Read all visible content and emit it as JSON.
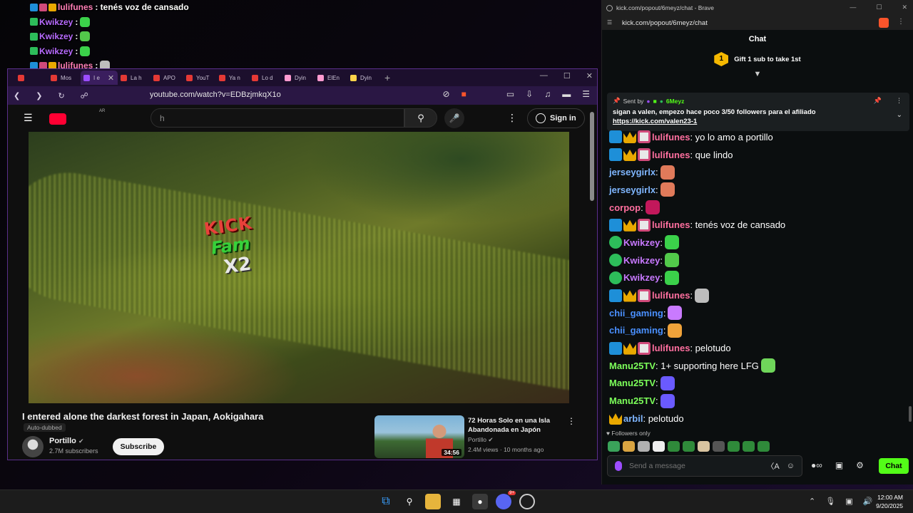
{
  "overlay_chat": [
    {
      "user": "lulifunes",
      "color": "#ff7eb6",
      "text": ": tenés voz de cansado",
      "badges": [
        "#1e8fd8",
        "#d04a7a",
        "#e9a800"
      ],
      "emote": ""
    },
    {
      "user": "Kwikzey",
      "color": "#b86bff",
      "text": ":",
      "badges": [
        "#2dbd5a"
      ],
      "emote": "#3bd14a"
    },
    {
      "user": "Kwikzey",
      "color": "#b86bff",
      "text": ":",
      "badges": [
        "#2dbd5a"
      ],
      "emote": "#52c94a"
    },
    {
      "user": "Kwikzey",
      "color": "#b86bff",
      "text": ":",
      "badges": [
        "#2dbd5a"
      ],
      "emote": "#3bd14a"
    },
    {
      "user": "lulifunes",
      "color": "#ff7eb6",
      "text": ":",
      "badges": [
        "#1e8fd8",
        "#d04a7a",
        "#e9a800"
      ],
      "emote": "#bdbdbd"
    },
    {
      "user": "chii_gaming",
      "color": "#4a90ff",
      "text": ":",
      "badges": [],
      "emote": "#c97aff"
    },
    {
      "user": "chii_gaming",
      "color": "#4a90ff",
      "text": ":",
      "badges": [],
      "emote": "#f0a33a"
    },
    {
      "user": "lulifunes",
      "color": "#ff7eb6",
      "text": ": pelotudo",
      "badges": [
        "#1e8fd8",
        "#d04a7a",
        "#e9a800"
      ],
      "emote": ""
    },
    {
      "user": "Manu25TV",
      "color": "#7cff5a",
      "text": ": 1+ supporting here LFG",
      "badges": [],
      "emote": "#3bd14a"
    },
    {
      "user": "Manu25TV",
      "color": "#7cff5a",
      "text": ":",
      "badges": [],
      "emote": "#6a5aff"
    },
    {
      "user": "Manu25TV",
      "color": "#7cff5a",
      "text": ":",
      "badges": [],
      "emote": "#6a5aff"
    },
    {
      "user": "arbil",
      "color": "#ffffff",
      "text": ": pelotudo",
      "badges": [
        "#e9a800"
      ],
      "emote": ""
    }
  ],
  "browser": {
    "tabs": [
      {
        "label": "",
        "active": false,
        "color": "#e53935"
      },
      {
        "label": "Mos",
        "active": false,
        "color": "#e53935"
      },
      {
        "label": "I e",
        "active": true,
        "color": "#9c4dff"
      },
      {
        "label": "La h",
        "active": false,
        "color": "#e53935"
      },
      {
        "label": "APO",
        "active": false,
        "color": "#e53935"
      },
      {
        "label": "YouT",
        "active": false,
        "color": "#e53935"
      },
      {
        "label": "Ya n",
        "active": false,
        "color": "#e53935"
      },
      {
        "label": "Lo d",
        "active": false,
        "color": "#e53935"
      },
      {
        "label": "Dyin",
        "active": false,
        "color": "#ff9bd0"
      },
      {
        "label": "ElEn",
        "active": false,
        "color": "#ff9bd0"
      },
      {
        "label": "Dyin",
        "active": false,
        "color": "#ffd54a"
      }
    ],
    "url": "youtube.com/watch?v=EDBzjmkqX1o"
  },
  "youtube": {
    "search_placeholder": "h",
    "sign_in": "Sign in",
    "logo_badge": "AR",
    "video_title": "I entered alone the darkest forest in Japan, Aokigahara",
    "auto_dubbed": "Auto-dubbed",
    "channel": "Portillo",
    "subscribers": "2.7M subscribers",
    "subscribe": "Subscribe",
    "overlay_logo": {
      "kick": "KICK",
      "fam": "Fam",
      "x2": "X2"
    },
    "recommendation": {
      "title": "72 Horas Solo en una Isla Abandonada en Japón",
      "channel": "Portillo",
      "meta": "2.4M views · 10 months ago",
      "duration": "34:56"
    }
  },
  "kick": {
    "window_title": "kick.com/popout/6meyz/chat - Brave",
    "url": "kick.com/popout/6meyz/chat",
    "header": "Chat",
    "gift_count": "1",
    "gift_text": "Gift 1 sub to take 1st",
    "pinned": {
      "sent_by": "Sent by",
      "sender": "6Meyz",
      "message": "sigan a valen, empezo hace poco 3/50 followers para el afiliado",
      "link": "https://kick.com/valen23-1"
    },
    "messages": [
      {
        "user": "lulifunes",
        "color": "#ff6f9f",
        "badges": [
          "mod",
          "vip",
          "og"
        ],
        "text": ": yo lo amo a portillo",
        "emote": ""
      },
      {
        "user": "lulifunes",
        "color": "#ff6f9f",
        "badges": [
          "mod",
          "vip",
          "og"
        ],
        "text": ": que lindo",
        "emote": ""
      },
      {
        "user": "jerseygirlx",
        "color": "#7fb6ff",
        "badges": [],
        "text": ":",
        "emote": "#e07a5a"
      },
      {
        "user": "jerseygirlx",
        "color": "#7fb6ff",
        "badges": [],
        "text": ":",
        "emote": "#e07a5a"
      },
      {
        "user": "corpop",
        "color": "#ff6f9f",
        "badges": [],
        "text": ":",
        "emote": "#c2185b"
      },
      {
        "user": "lulifunes",
        "color": "#ff6f9f",
        "badges": [
          "mod",
          "vip",
          "og"
        ],
        "text": ": tenés voz de cansado",
        "emote": ""
      },
      {
        "user": "Kwikzey",
        "color": "#c879ff",
        "badges": [
          "ver"
        ],
        "text": ":",
        "emote": "#3bd14a"
      },
      {
        "user": "Kwikzey",
        "color": "#c879ff",
        "badges": [
          "ver"
        ],
        "text": ":",
        "emote": "#52c94a"
      },
      {
        "user": "Kwikzey",
        "color": "#c879ff",
        "badges": [
          "ver"
        ],
        "text": ":",
        "emote": "#3bd14a"
      },
      {
        "user": "lulifunes",
        "color": "#ff6f9f",
        "badges": [
          "mod",
          "vip",
          "og"
        ],
        "text": ":",
        "emote": "#bdbdbd"
      },
      {
        "user": "chii_gaming",
        "color": "#4a90ff",
        "badges": [],
        "text": ":",
        "emote": "#c97aff"
      },
      {
        "user": "chii_gaming",
        "color": "#4a90ff",
        "badges": [],
        "text": ":",
        "emote": "#f0a33a"
      },
      {
        "user": "lulifunes",
        "color": "#ff6f9f",
        "badges": [
          "mod",
          "vip",
          "og"
        ],
        "text": ": pelotudo",
        "emote": ""
      },
      {
        "user": "Manu25TV",
        "color": "#7cff5a",
        "badges": [],
        "text": ": 1+ supporting here LFG",
        "emote": "#6fd65a"
      },
      {
        "user": "Manu25TV",
        "color": "#7cff5a",
        "badges": [],
        "text": ":",
        "emote": "#6a5aff"
      },
      {
        "user": "Manu25TV",
        "color": "#7cff5a",
        "badges": [],
        "text": ":",
        "emote": "#6a5aff"
      },
      {
        "user": "arbil",
        "color": "#7fb6ff",
        "badges": [
          "vip"
        ],
        "text": ": pelotudo",
        "emote": ""
      }
    ],
    "followers_only": "Followers only",
    "quick_emotes": [
      "#3aa35a",
      "#d9a441",
      "#b0b0b0",
      "#eeeeee",
      "#2f8a3a",
      "#2f8a3a",
      "#d9c4a0",
      "#555555",
      "#2f8a3a",
      "#2f8a3a",
      "#2f8a3a"
    ],
    "input_placeholder": "Send a message",
    "send_label": "Chat",
    "accent": "#53fc18"
  },
  "taskbar": {
    "time": "12:00 AM",
    "date": "9/20/2025",
    "discord_badge": "9+"
  }
}
